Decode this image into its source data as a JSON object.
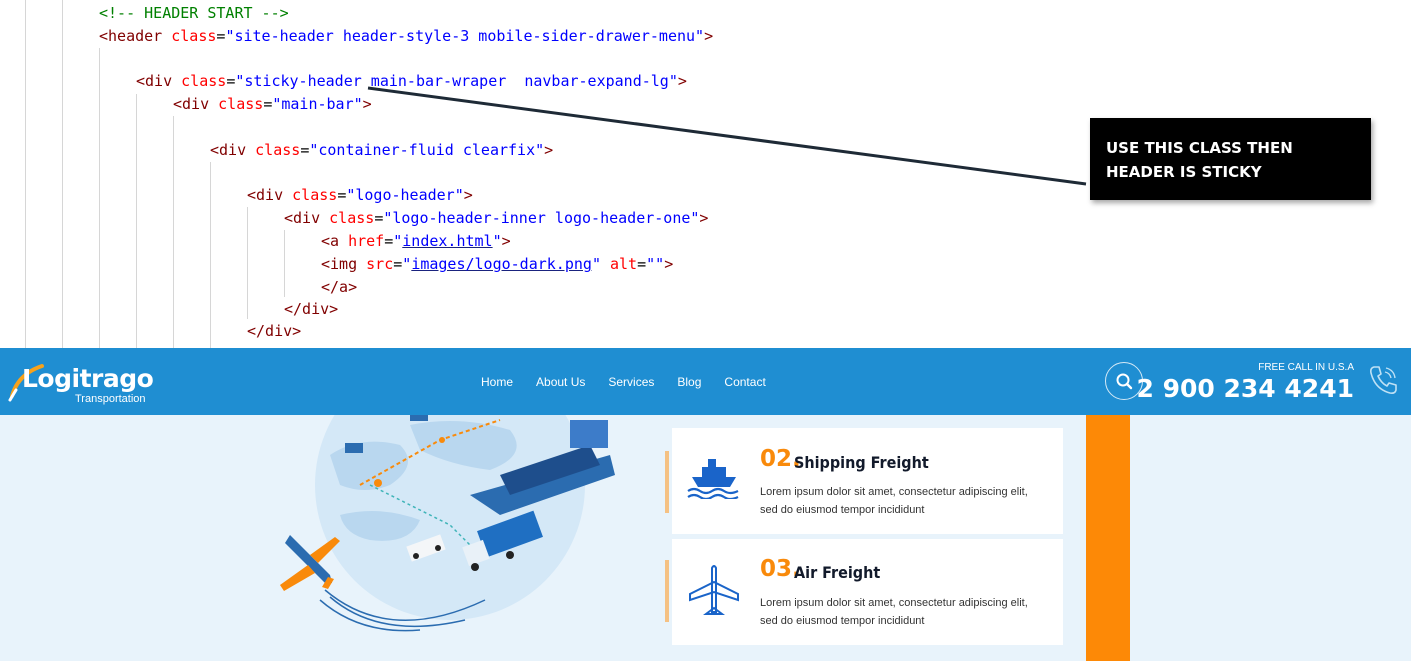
{
  "code": {
    "lines": [
      {
        "parts": [
          {
            "c": "comment",
            "t": "<!-- HEADER START -->"
          }
        ]
      },
      {
        "parts": [
          {
            "c": "tag",
            "t": "<header "
          },
          {
            "c": "attr",
            "t": "class"
          },
          {
            "c": "plain",
            "t": "="
          },
          {
            "c": "val",
            "t": "\"site-header header-style-3 mobile-sider-drawer-menu\""
          },
          {
            "c": "tag",
            "t": ">"
          }
        ]
      },
      {
        "parts": [
          {
            "c": "tag",
            "t": "<div "
          },
          {
            "c": "attr",
            "t": "class"
          },
          {
            "c": "plain",
            "t": "="
          },
          {
            "c": "val",
            "t": "\"sticky-header main-bar-wraper  navbar-expand-lg\""
          },
          {
            "c": "tag",
            "t": ">"
          }
        ]
      },
      {
        "parts": [
          {
            "c": "tag",
            "t": "<div "
          },
          {
            "c": "attr",
            "t": "class"
          },
          {
            "c": "plain",
            "t": "="
          },
          {
            "c": "val",
            "t": "\"main-bar\""
          },
          {
            "c": "tag",
            "t": ">"
          }
        ]
      },
      {
        "parts": [
          {
            "c": "tag",
            "t": "<div "
          },
          {
            "c": "attr",
            "t": "class"
          },
          {
            "c": "plain",
            "t": "="
          },
          {
            "c": "val",
            "t": "\"container-fluid clearfix\""
          },
          {
            "c": "tag",
            "t": ">"
          }
        ]
      },
      {
        "parts": [
          {
            "c": "tag",
            "t": "<div "
          },
          {
            "c": "attr",
            "t": "class"
          },
          {
            "c": "plain",
            "t": "="
          },
          {
            "c": "val",
            "t": "\"logo-header\""
          },
          {
            "c": "tag",
            "t": ">"
          }
        ]
      },
      {
        "parts": [
          {
            "c": "tag",
            "t": "<div "
          },
          {
            "c": "attr",
            "t": "class"
          },
          {
            "c": "plain",
            "t": "="
          },
          {
            "c": "val",
            "t": "\"logo-header-inner logo-header-one\""
          },
          {
            "c": "tag",
            "t": ">"
          }
        ]
      },
      {
        "parts": [
          {
            "c": "tag",
            "t": "<a "
          },
          {
            "c": "attr",
            "t": "href"
          },
          {
            "c": "plain",
            "t": "="
          },
          {
            "c": "val",
            "t": "\""
          },
          {
            "c": "link",
            "t": "index.html"
          },
          {
            "c": "val",
            "t": "\""
          },
          {
            "c": "tag",
            "t": ">"
          }
        ]
      },
      {
        "parts": [
          {
            "c": "tag",
            "t": "<img "
          },
          {
            "c": "attr",
            "t": "src"
          },
          {
            "c": "plain",
            "t": "="
          },
          {
            "c": "val",
            "t": "\""
          },
          {
            "c": "link",
            "t": "images/logo-dark.png"
          },
          {
            "c": "val",
            "t": "\" "
          },
          {
            "c": "attr",
            "t": "alt"
          },
          {
            "c": "plain",
            "t": "="
          },
          {
            "c": "val",
            "t": "\"\""
          },
          {
            "c": "tag",
            "t": ">"
          }
        ]
      },
      {
        "parts": [
          {
            "c": "tag",
            "t": "</a>"
          }
        ]
      },
      {
        "parts": [
          {
            "c": "tag",
            "t": "</div>"
          }
        ]
      },
      {
        "parts": [
          {
            "c": "tag",
            "t": "</div>"
          }
        ]
      }
    ],
    "callout_text": "USE THIS CLASS THEN HEADER IS STICKY"
  },
  "site": {
    "logo_text": "Logitrago",
    "logo_subtext": "Transportation",
    "nav": [
      "Home",
      "About Us",
      "Services",
      "Blog",
      "Contact"
    ],
    "call_label": "FREE CALL IN U.S.A",
    "phone": "2 900 234 4241",
    "services": [
      {
        "num": "02.",
        "title": "Shipping Freight",
        "icon": "ship-icon",
        "desc_line1": "Lorem ipsum dolor sit amet, consectetur adipiscing elit,",
        "desc_line2": "sed do eiusmod tempor incididunt"
      },
      {
        "num": "03.",
        "title": "Air Freight",
        "icon": "airplane-icon",
        "desc_line1": "Lorem ipsum dolor sit amet, consectetur adipiscing elit,",
        "desc_line2": "sed do eiusmod tempor incididunt"
      }
    ]
  },
  "colors": {
    "header_blue": "#1f8ed2",
    "accent_orange": "#fd8906",
    "callout_bg": "#000000"
  }
}
